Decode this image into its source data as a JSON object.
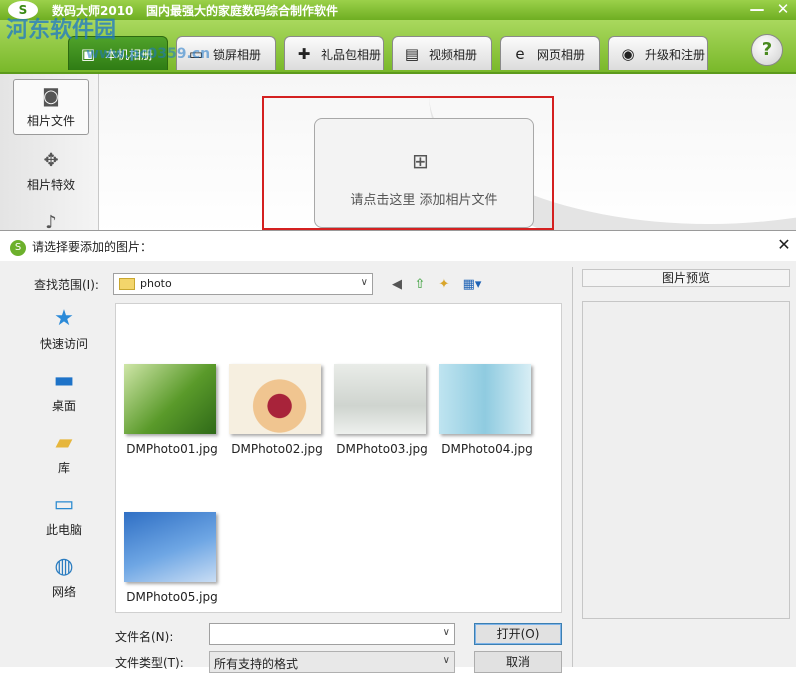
{
  "app": {
    "title": "数码大师2010",
    "slogan": "国内最强大的家庭数码综合制作软件",
    "logo_text": "S",
    "watermark": "河东软件园",
    "watermark_url": "www.pc0359.cn",
    "minimize_glyph": "—",
    "close_glyph": "✕"
  },
  "tabs": [
    {
      "label": "本机相册",
      "icon": "photo-album-icon",
      "glyph": "▣"
    },
    {
      "label": "锁屏相册",
      "icon": "monitor-icon",
      "glyph": "▭"
    },
    {
      "label": "礼品包相册",
      "icon": "gift-icon",
      "glyph": "✚"
    },
    {
      "label": "视频相册",
      "icon": "film-icon",
      "glyph": "▤"
    },
    {
      "label": "网页相册",
      "icon": "ie-icon",
      "glyph": "e"
    },
    {
      "label": "升级和注册",
      "icon": "globe-icon",
      "glyph": "◉"
    }
  ],
  "help_glyph": "?",
  "leftnav": [
    {
      "label": "相片文件",
      "icon": "camera-icon",
      "glyph": "◙"
    },
    {
      "label": "相片特效",
      "icon": "effects-icon",
      "glyph": "✥"
    },
    {
      "label": "",
      "icon": "music-icon",
      "glyph": "♪"
    }
  ],
  "canvas": {
    "add_label": "请点击这里  添加相片文件",
    "add_glyph": "⊞"
  },
  "dialog": {
    "title": "请选择要添加的图片：",
    "close_glyph": "✕",
    "look_in_label": "查找范围(I):",
    "look_in_value": "photo",
    "toolbar": {
      "back": "◀",
      "up": "⇧",
      "new_folder": "✦",
      "views": "▦▾"
    },
    "places": [
      {
        "label": "快速访问",
        "icon": "star-icon",
        "glyph": "★",
        "color": "#2b8ad8"
      },
      {
        "label": "桌面",
        "icon": "desktop-icon",
        "glyph": "▬",
        "color": "#1e73c8"
      },
      {
        "label": "库",
        "icon": "library-icon",
        "glyph": "▰",
        "color": "#e6b63c"
      },
      {
        "label": "此电脑",
        "icon": "computer-icon",
        "glyph": "▭",
        "color": "#2a8ad0"
      },
      {
        "label": "网络",
        "icon": "network-icon",
        "glyph": "◍",
        "color": "#2a7cc0"
      }
    ],
    "files": [
      {
        "name": "DMPhoto01.jpg",
        "thumb": "linear-gradient(135deg,#cfe6a8,#5a9a2a 55%,#2f6a18)"
      },
      {
        "name": "DMPhoto02.jpg",
        "thumb": "radial-gradient(circle at 55% 60%,#a8233a 0 18%,#f0c590 19% 40%,#f6efe0 41%)"
      },
      {
        "name": "DMPhoto03.jpg",
        "thumb": "linear-gradient(180deg,#e9ece8,#cfd4cf 60%,#eef0ee)"
      },
      {
        "name": "DMPhoto04.jpg",
        "thumb": "linear-gradient(90deg,#bfe4f0,#8fcbe0 50%,#d8eef5)"
      },
      {
        "name": "DMPhoto05.jpg",
        "thumb": "linear-gradient(160deg,#2f6fc4,#6ea6e4 55%,#c9ddf4)"
      }
    ],
    "file_name_label": "文件名(N):",
    "file_name_value": "",
    "file_type_label": "文件类型(T):",
    "file_type_value": "所有支持的格式",
    "open_label": "打开(O)",
    "cancel_label": "取消",
    "preview_label": "图片预览"
  }
}
